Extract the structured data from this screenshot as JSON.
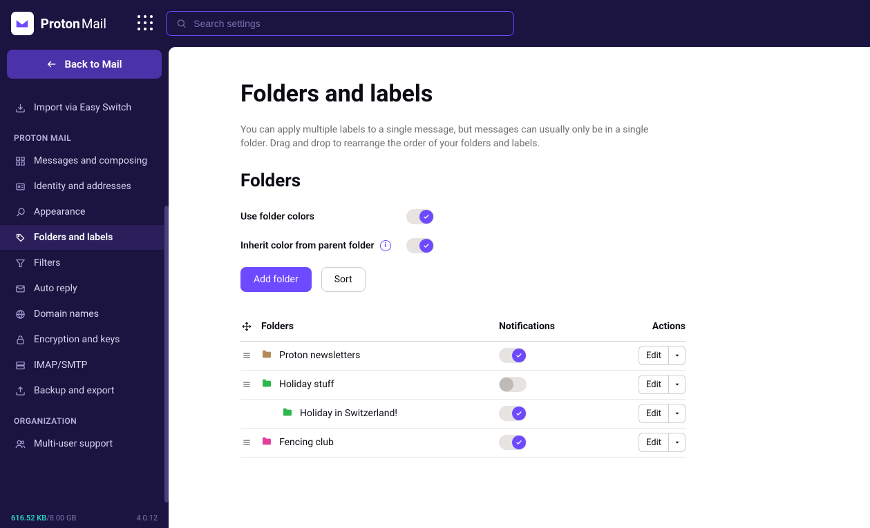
{
  "brand": {
    "name1": "Proton",
    "name2": "Mail"
  },
  "search": {
    "placeholder": "Search settings"
  },
  "back_button": "Back to Mail",
  "import_link": "Import via Easy Switch",
  "nav_sections": {
    "proton_mail_title": "PROTON MAIL",
    "organization_title": "ORGANIZATION"
  },
  "nav": {
    "messages": "Messages and composing",
    "identity": "Identity and addresses",
    "appearance": "Appearance",
    "folders": "Folders and labels",
    "filters": "Filters",
    "autoreply": "Auto reply",
    "domains": "Domain names",
    "encryption": "Encryption and keys",
    "imap": "IMAP/SMTP",
    "backup": "Backup and export",
    "multiuser": "Multi-user support"
  },
  "storage": {
    "used": "616.52 KB",
    "sep": " / ",
    "total": "8.00 GB"
  },
  "version": "4.0.12",
  "page": {
    "title": "Folders and labels",
    "description": "You can apply multiple labels to a single message, but messages can usually only be in a single folder. Drag and drop to rearrange the order of your folders and labels.",
    "folders_heading": "Folders",
    "use_colors_label": "Use folder colors",
    "inherit_label": "Inherit color from parent folder",
    "add_folder": "Add folder",
    "sort": "Sort"
  },
  "table": {
    "col_folders": "Folders",
    "col_notifications": "Notifications",
    "col_actions": "Actions",
    "edit_label": "Edit"
  },
  "folders": [
    {
      "name": "Proton newsletters",
      "color": "#b08d57",
      "notifications": true,
      "indent": 0
    },
    {
      "name": "Holiday stuff",
      "color": "#2db84d",
      "notifications": false,
      "indent": 0
    },
    {
      "name": "Holiday in Switzerland!",
      "color": "#2db84d",
      "notifications": true,
      "indent": 1
    },
    {
      "name": "Fencing club",
      "color": "#e0409a",
      "notifications": true,
      "indent": 0
    }
  ],
  "settings": {
    "use_folder_colors": true,
    "inherit_color": true
  }
}
